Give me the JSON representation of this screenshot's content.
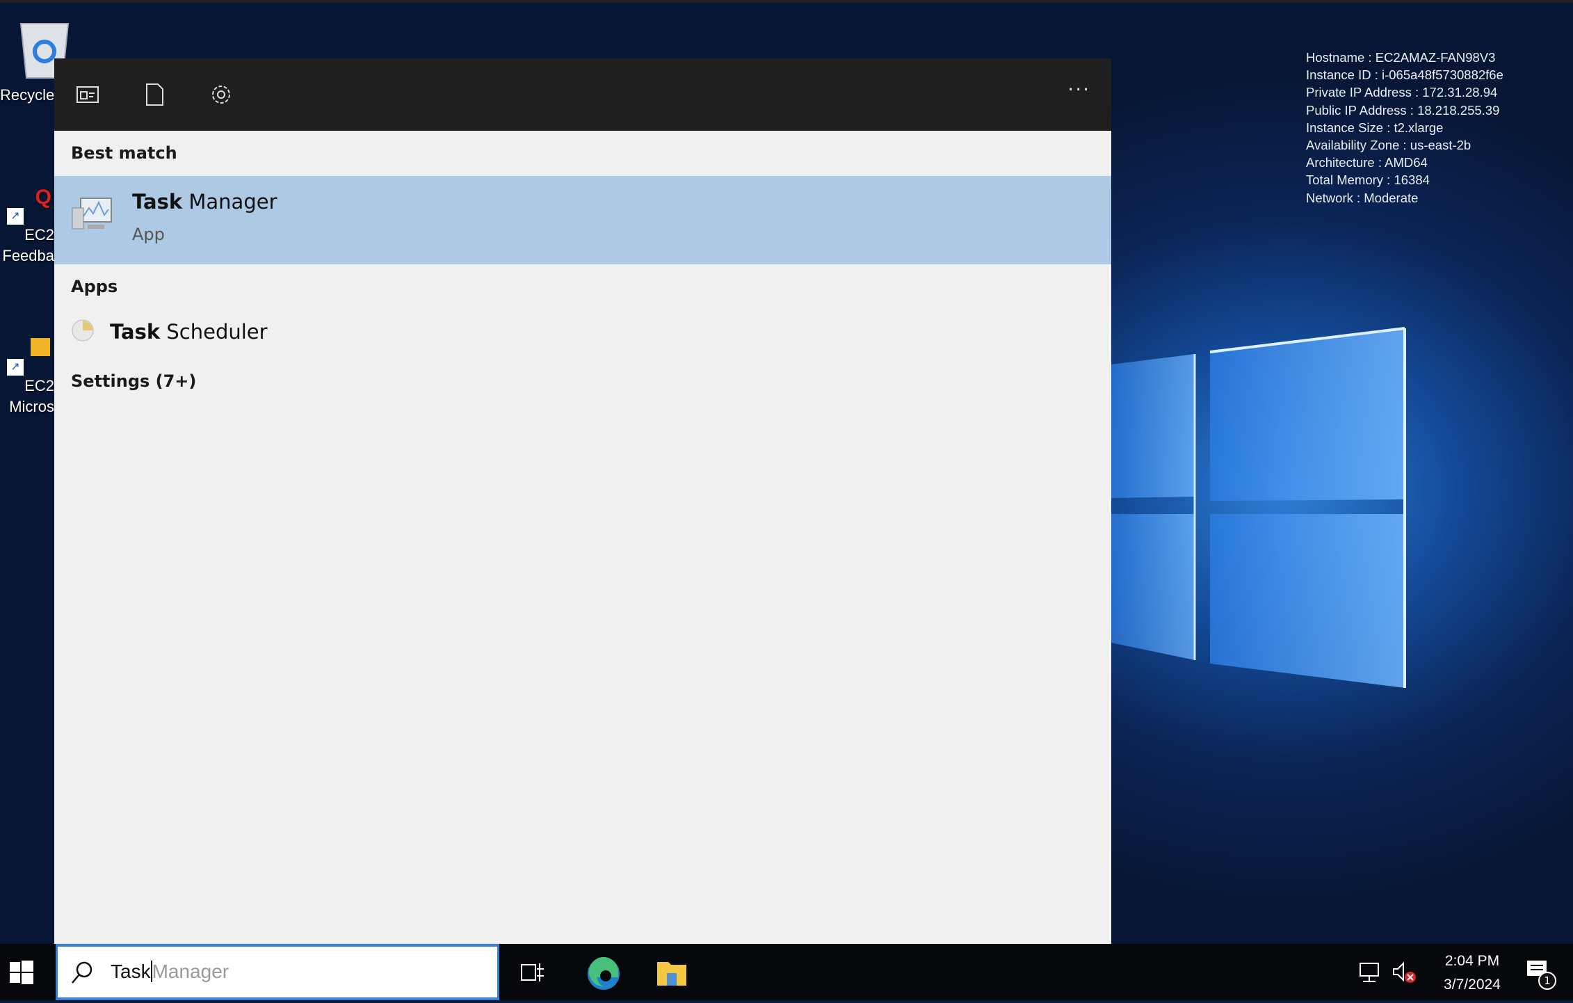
{
  "desktop": {
    "icons": [
      {
        "label": "Recycle",
        "icon": "recycle-bin-icon"
      },
      {
        "label_line1": "EC2",
        "label_line2": "Feedba",
        "icon": "ec2-feedback-shortcut-icon"
      },
      {
        "label_line1": "EC2",
        "label_line2": "Micros",
        "icon": "ec2-microsoft-shortcut-icon"
      }
    ],
    "info": [
      "Hostname : EC2AMAZ-FAN98V3",
      "Instance ID : i-065a48f5730882f6e",
      "Private IP Address : 172.31.28.94",
      "Public IP Address : 18.218.255.39",
      "Instance Size : t2.xlarge",
      "Availability Zone : us-east-2b",
      "Architecture : AMD64",
      "Total Memory : 16384",
      "Network : Moderate"
    ]
  },
  "search_panel": {
    "header_icons": [
      "apps-filter-icon",
      "documents-filter-icon",
      "settings-filter-icon"
    ],
    "more_label": "···",
    "best_match_heading": "Best match",
    "best_match": {
      "title_bold": "Task",
      "title_rest": " Manager",
      "subtitle": "App"
    },
    "apps_heading": "Apps",
    "apps": [
      {
        "title_bold": "Task",
        "title_rest": " Scheduler"
      }
    ],
    "settings_heading": "Settings (7+)",
    "highlight_color": "#adc9e4"
  },
  "taskbar": {
    "search_typed": "Task",
    "search_suggestion": "Manager",
    "clock_time": "2:04 PM",
    "clock_date": "3/7/2024",
    "notification_count": "1",
    "accent": "#3b7ed8"
  }
}
